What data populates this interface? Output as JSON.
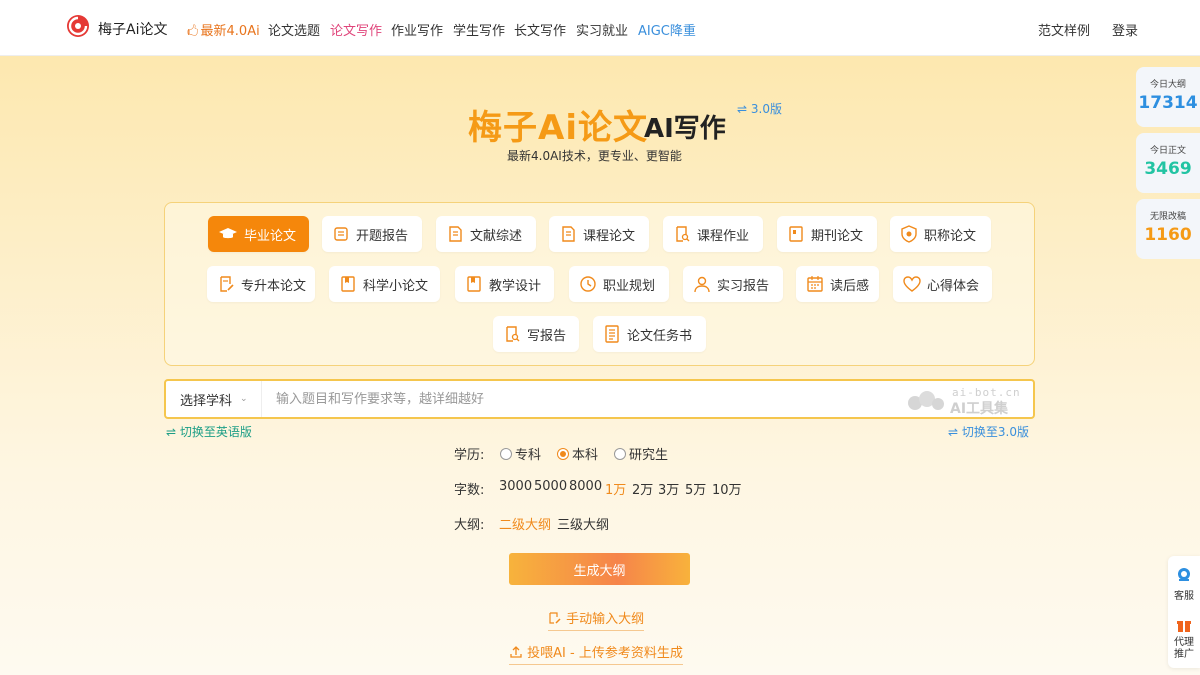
{
  "nav": {
    "brand": "梅子Ai论文",
    "items": [
      {
        "label": "最新4.0Ai"
      },
      {
        "label": "论文选题"
      },
      {
        "label": "论文写作"
      },
      {
        "label": "作业写作"
      },
      {
        "label": "学生写作"
      },
      {
        "label": "长文写作"
      },
      {
        "label": "实习就业"
      },
      {
        "label": "AIGC降重"
      }
    ],
    "samples": "范文样例",
    "login": "登录"
  },
  "hero": {
    "title": "梅子Ai论文",
    "subtitle": "AI写作",
    "version": "⇌ 3.0版",
    "tagline": "最新4.0AI技术，更专业、更智能"
  },
  "stats": [
    {
      "label": "今日大纲",
      "value": "17314",
      "color": "#2d8fe0"
    },
    {
      "label": "今日正文",
      "value": "3469",
      "color": "#22c4a3"
    },
    {
      "label": "无限改稿",
      "value": "1160",
      "color": "#f59a16"
    }
  ],
  "categories": [
    {
      "label": "毕业论文",
      "icon": "graduation-cap-icon"
    },
    {
      "label": "开题报告",
      "icon": "report-icon"
    },
    {
      "label": "文献综述",
      "icon": "document-icon"
    },
    {
      "label": "课程论文",
      "icon": "document-icon"
    },
    {
      "label": "课程作业",
      "icon": "document-search-icon"
    },
    {
      "label": "期刊论文",
      "icon": "journal-icon"
    },
    {
      "label": "职称论文",
      "icon": "badge-icon"
    },
    {
      "label": "专升本论文",
      "icon": "document-edit-icon"
    },
    {
      "label": "科学小论文",
      "icon": "book-icon"
    },
    {
      "label": "教学设计",
      "icon": "book-icon"
    },
    {
      "label": "职业规划",
      "icon": "clock-icon"
    },
    {
      "label": "实习报告",
      "icon": "user-icon"
    },
    {
      "label": "读后感",
      "icon": "calendar-icon"
    },
    {
      "label": "心得体会",
      "icon": "heart-icon"
    },
    {
      "label": "写报告",
      "icon": "document-search-icon"
    },
    {
      "label": "论文任务书",
      "icon": "list-document-icon"
    }
  ],
  "input": {
    "subject": "选择学科",
    "placeholder": "输入题目和写作要求等，越详细越好",
    "watermark_domain": "ai-bot.cn",
    "watermark_name": "AI工具集"
  },
  "switches": {
    "english": "⇌ 切换至英语版",
    "v3": "⇌ 切换至3.0版"
  },
  "options": {
    "education_label": "学历:",
    "education": [
      {
        "label": "专科",
        "selected": false
      },
      {
        "label": "本科",
        "selected": true
      },
      {
        "label": "研究生",
        "selected": false
      }
    ],
    "words_label": "字数:",
    "words": [
      {
        "label": "3000",
        "selected": false
      },
      {
        "label": "5000",
        "selected": false
      },
      {
        "label": "8000",
        "selected": false
      },
      {
        "label": "1万",
        "selected": true
      },
      {
        "label": "2万",
        "selected": false
      },
      {
        "label": "3万",
        "selected": false
      },
      {
        "label": "5万",
        "selected": false
      },
      {
        "label": "10万",
        "selected": false
      }
    ],
    "outline_label": "大纲:",
    "outline": [
      {
        "label": "二级大纲",
        "selected": true
      },
      {
        "label": "三级大纲",
        "selected": false
      }
    ]
  },
  "actions": {
    "generate": "生成大纲",
    "manual": "手动输入大纲",
    "upload": "投喂AI - 上传参考资料生成"
  },
  "side": {
    "service": "客服",
    "agent": "代理推广"
  }
}
